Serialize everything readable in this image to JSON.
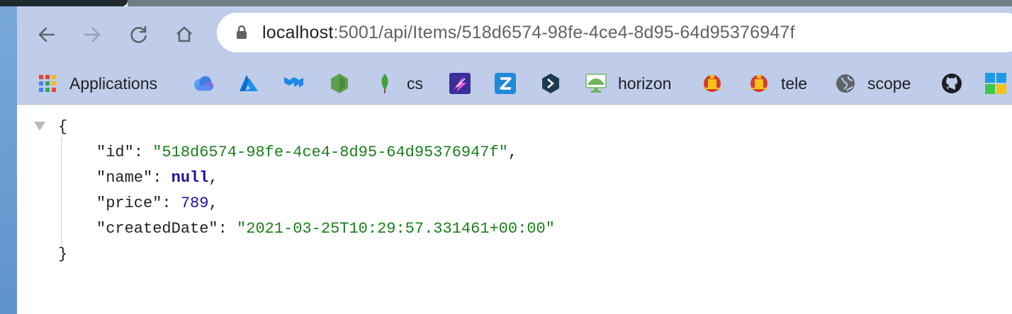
{
  "browser": {
    "url_host": "localhost",
    "url_path": ":5001/api/Items/518d6574-98fe-4ce4-8d95-64d95376947f",
    "nav": {
      "back_icon": "arrow-left-icon",
      "forward_icon": "arrow-right-icon",
      "reload_icon": "reload-icon",
      "home_icon": "home-icon",
      "lock_icon": "lock-icon"
    }
  },
  "bookmarks": [
    {
      "label": "Applications",
      "icon": "apps-grid-icon"
    },
    {
      "label": "",
      "icon": "cloud-icon"
    },
    {
      "label": "",
      "icon": "azure-icon"
    },
    {
      "label": "",
      "icon": "mui-icon"
    },
    {
      "label": "",
      "icon": "nodejs-icon"
    },
    {
      "label": "cs",
      "icon": "mongodb-leaf-icon"
    },
    {
      "label": "",
      "icon": "lightning-icon"
    },
    {
      "label": "",
      "icon": "z-icon"
    },
    {
      "label": "",
      "icon": "arrow-chevron-icon"
    },
    {
      "label": "horizon",
      "icon": "horizon-icon"
    },
    {
      "label": "",
      "icon": "crest-icon"
    },
    {
      "label": "tele",
      "icon": "crest-icon"
    },
    {
      "label": "scope",
      "icon": "globe-icon"
    },
    {
      "label": "",
      "icon": "github-icon"
    },
    {
      "label": "",
      "icon": "windows-icon"
    }
  ],
  "json": {
    "open_brace": "{",
    "close_brace": "}",
    "fields": [
      {
        "key": "\"id\"",
        "value": "\"518d6574-98fe-4ce4-8d95-64d95376947f\"",
        "type": "str",
        "comma": ","
      },
      {
        "key": "\"name\"",
        "value": "null",
        "type": "kw",
        "comma": ","
      },
      {
        "key": "\"price\"",
        "value": "789",
        "type": "num",
        "comma": ","
      },
      {
        "key": "\"createdDate\"",
        "value": "\"2021-03-25T10:29:57.331461+00:00\"",
        "type": "str",
        "comma": ""
      }
    ]
  },
  "colors": {
    "chrome_bg": "#bfcdea",
    "string": "#1a7f1a",
    "keyword": "#1f10a3"
  }
}
